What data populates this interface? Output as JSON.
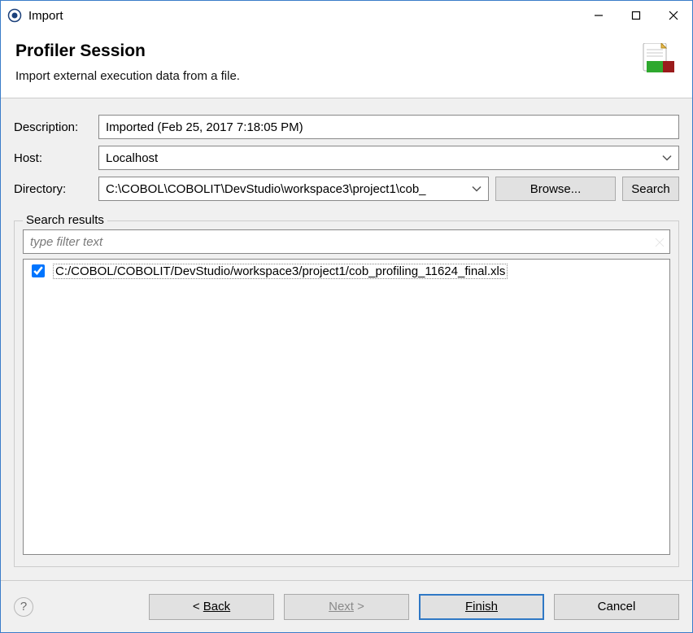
{
  "window": {
    "title": "Import"
  },
  "header": {
    "title": "Profiler Session",
    "subtitle": "Import external execution data from a file."
  },
  "form": {
    "description_label": "Description:",
    "description_value": "Imported (Feb 25, 2017 7:18:05 PM)",
    "host_label": "Host:",
    "host_value": "Localhost",
    "directory_label": "Directory:",
    "directory_value": "C:\\COBOL\\COBOLIT\\DevStudio\\workspace3\\project1\\cob_",
    "browse_label": "Browse...",
    "search_label": "Search"
  },
  "results": {
    "legend": "Search results",
    "filter_placeholder": "type filter text",
    "items": [
      {
        "checked": true,
        "path": "C:/COBOL/COBOLIT/DevStudio/workspace3/project1/cob_profiling_11624_final.xls"
      }
    ]
  },
  "buttons": {
    "back": "Back",
    "next": "Next",
    "finish": "Finish",
    "cancel": "Cancel"
  }
}
